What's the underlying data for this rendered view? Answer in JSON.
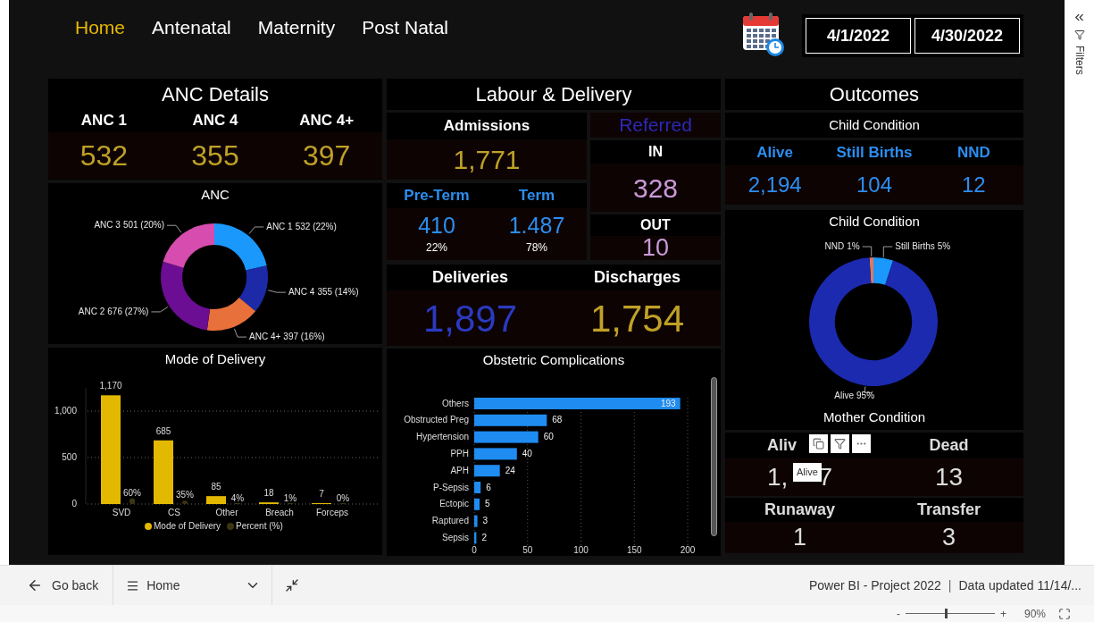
{
  "nav": {
    "tabs": [
      {
        "label": "Home",
        "selected": true
      },
      {
        "label": "Antenatal",
        "selected": false
      },
      {
        "label": "Maternity",
        "selected": false
      },
      {
        "label": "Post Natal",
        "selected": false
      }
    ]
  },
  "date_range": {
    "start": "4/1/2022",
    "end": "4/30/2022"
  },
  "anc_details": {
    "title": "ANC Details",
    "kpis": [
      {
        "label": "ANC 1",
        "value": "532"
      },
      {
        "label": "ANC 4",
        "value": "355"
      },
      {
        "label": "ANC 4+",
        "value": "397"
      }
    ]
  },
  "anc_chart": {
    "title": "ANC",
    "chart_data": {
      "type": "donut",
      "categories": [
        "ANC 1",
        "ANC 4",
        "ANC 4+",
        "ANC 2",
        "ANC 3"
      ],
      "values": [
        532,
        355,
        397,
        676,
        501
      ],
      "colors": [
        "#1a98fc",
        "#1c2aa8",
        "#e8703a",
        "#6b0e93",
        "#d64caf"
      ],
      "value_labels": [
        "532 (22%)",
        "355 (14%)",
        "397 (16%)",
        "676 (27%)",
        "501 (20%)"
      ]
    }
  },
  "mode_of_delivery": {
    "title": "Mode of Delivery",
    "chart_data": {
      "type": "bar",
      "orientation": "vertical",
      "grid": true,
      "legend": true,
      "ylim": [
        0,
        1250
      ],
      "categories": [
        "SVD",
        "CS",
        "Other",
        "Breach",
        "Forceps"
      ],
      "yticks": [
        {
          "value": 0,
          "label": "0"
        },
        {
          "value": 500,
          "label": "500"
        },
        {
          "value": 1000,
          "label": "1,000"
        }
      ],
      "series": [
        {
          "name": "Mode of Delivery",
          "color": "#e3b800",
          "values": [
            1170,
            685,
            85,
            18,
            7
          ],
          "value_labels": [
            "1,170",
            "685",
            "85",
            "18",
            "7"
          ]
        },
        {
          "name": "Percent (%)",
          "color": "#3b3510",
          "values": [
            60,
            35,
            4,
            1,
            0
          ],
          "value_labels": [
            "60%",
            "35%",
            "4%",
            "1%",
            "0%"
          ]
        }
      ]
    }
  },
  "labour": {
    "title": "Labour & Delivery",
    "admissions": {
      "label": "Admissions",
      "value": "1,771"
    },
    "term": [
      {
        "label": "Pre-Term",
        "value": "410",
        "percent": "22%"
      },
      {
        "label": "Term",
        "value": "1.487",
        "percent": "78%"
      }
    ],
    "referred": {
      "title": "Referred",
      "in": {
        "label": "IN",
        "value": "328"
      },
      "out": {
        "label": "OUT",
        "value": "10"
      }
    },
    "deliveries": {
      "label": "Deliveries",
      "value": "1,897"
    },
    "discharges": {
      "label": "Discharges",
      "value": "1,754"
    }
  },
  "complications": {
    "title": "Obstetric Complications",
    "chart_data": {
      "type": "bar",
      "orientation": "horizontal",
      "categories": [
        "Others",
        "Obstructed Preg",
        "Hypertension",
        "PPH",
        "APH",
        "P-Sepsis",
        "Ectopic",
        "Raptured",
        "Sepsis"
      ],
      "values": [
        193,
        68,
        60,
        40,
        24,
        6,
        5,
        3,
        2
      ],
      "xlim": [
        0,
        200
      ],
      "xticks": [
        0,
        50,
        100,
        150,
        200
      ],
      "grid": true,
      "data_labels": true
    }
  },
  "outcomes": {
    "title": "Outcomes",
    "child_heading": "Child Condition",
    "child_kpis": [
      {
        "label": "Alive",
        "value": "2,194"
      },
      {
        "label": "Still Births",
        "value": "104"
      },
      {
        "label": "NND",
        "value": "12"
      }
    ],
    "child_chart": {
      "title": "Child Condition",
      "chart_data": {
        "type": "donut",
        "categories": [
          "NND",
          "Still Births",
          "Alive"
        ],
        "values": [
          1,
          5,
          95
        ],
        "colors": [
          "#e0785c",
          "#1a98fc",
          "#1c2ab0"
        ],
        "value_labels": [
          "1%",
          "5%",
          "95%"
        ]
      }
    },
    "mother_heading": "Mother Condition",
    "mother_kpis": [
      {
        "label": "Aliv",
        "value": "1,",
        "value_tail": "7"
      },
      {
        "label": "Dead",
        "value": "13"
      },
      {
        "label": "Runaway",
        "value": "1"
      },
      {
        "label": "Transfer",
        "value": "3"
      }
    ],
    "tooltip": "Alive"
  },
  "filters_pane": {
    "label": "Filters"
  },
  "footer": {
    "back": "Go back",
    "page": "Home",
    "source": "Power BI - Project 2022",
    "separator": "|",
    "updated": "Data updated 11/14/...",
    "zoom": {
      "minus": "-",
      "plus": "+",
      "level": 0.45,
      "percent": "90%"
    }
  }
}
